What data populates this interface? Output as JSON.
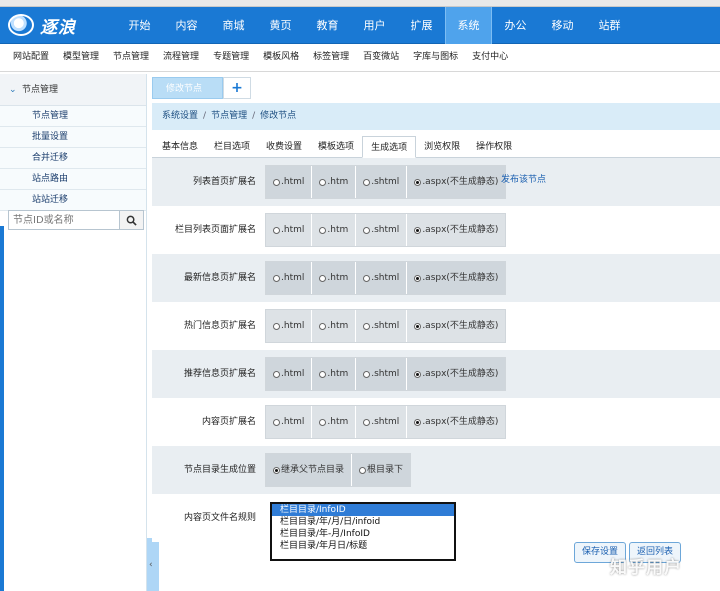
{
  "topbar": {
    "logo_text": "逐浪",
    "nav": [
      "开始",
      "内容",
      "商城",
      "黄页",
      "教育",
      "用户",
      "扩展",
      "系统",
      "办公",
      "移动",
      "站群"
    ],
    "active_index": 7
  },
  "subnav": [
    "网站配置",
    "模型管理",
    "节点管理",
    "流程管理",
    "专题管理",
    "模板风格",
    "标签管理",
    "百变微站",
    "字库与图标",
    "支付中心"
  ],
  "sidebar": {
    "heading": "节点管理",
    "items": [
      "节点管理",
      "批量设置",
      "合并迁移",
      "站点路由",
      "站站迁移"
    ],
    "search_placeholder": "节点ID或名称"
  },
  "content_tabs": {
    "current": "修改节点",
    "add": "+"
  },
  "breadcrumb": [
    "系统设置",
    "节点管理",
    "修改节点"
  ],
  "breadcrumb_sep": "/",
  "setting_tabs": [
    "基本信息",
    "栏目选项",
    "收费设置",
    "模板选项",
    "生成选项",
    "浏览权限",
    "操作权限"
  ],
  "active_setting_tab": 4,
  "rows": [
    {
      "label": "列表首页扩展名",
      "options": [
        ".html",
        ".htm",
        ".shtml",
        ".aspx(不生成静态)"
      ],
      "selected": 3,
      "link": "发布该节点"
    },
    {
      "label": "栏目列表页面扩展名",
      "options": [
        ".html",
        ".htm",
        ".shtml",
        ".aspx(不生成静态)"
      ],
      "selected": 3
    },
    {
      "label": "最新信息页扩展名",
      "options": [
        ".html",
        ".htm",
        ".shtml",
        ".aspx(不生成静态)"
      ],
      "selected": 3
    },
    {
      "label": "热门信息页扩展名",
      "options": [
        ".html",
        ".htm",
        ".shtml",
        ".aspx(不生成静态)"
      ],
      "selected": 3
    },
    {
      "label": "推荐信息页扩展名",
      "options": [
        ".html",
        ".htm",
        ".shtml",
        ".aspx(不生成静态)"
      ],
      "selected": 3
    },
    {
      "label": "内容页扩展名",
      "options": [
        ".html",
        ".htm",
        ".shtml",
        ".aspx(不生成静态)"
      ],
      "selected": 3
    },
    {
      "label": "节点目录生成位置",
      "options": [
        "继承父节点目录",
        "根目录下"
      ],
      "selected": 0
    },
    {
      "label": "内容页文件名规则",
      "options": []
    }
  ],
  "filename_rules": [
    "栏目目录/InfoID",
    "栏目目录/年/月/日/infoid",
    "栏目目录/年-月/InfoID",
    "栏目目录/年月日/标题"
  ],
  "filename_rule_selected": 0,
  "buttons": {
    "save": "保存设置",
    "back": "返回列表"
  },
  "browser_strip": [
    "",
    "",
    ""
  ],
  "watermark": "知乎用户",
  "colors": {
    "topbar": "#1a79d4",
    "active_nav": "#4fa3ec",
    "breadcrumb_bg": "#d9ecf8",
    "row_alt": "#e9eef2",
    "selected_option": "#2f7cd6"
  },
  "icons": {
    "search": "search-icon",
    "expand": "chevron-down-icon",
    "collapse": "chevron-left-icon"
  }
}
